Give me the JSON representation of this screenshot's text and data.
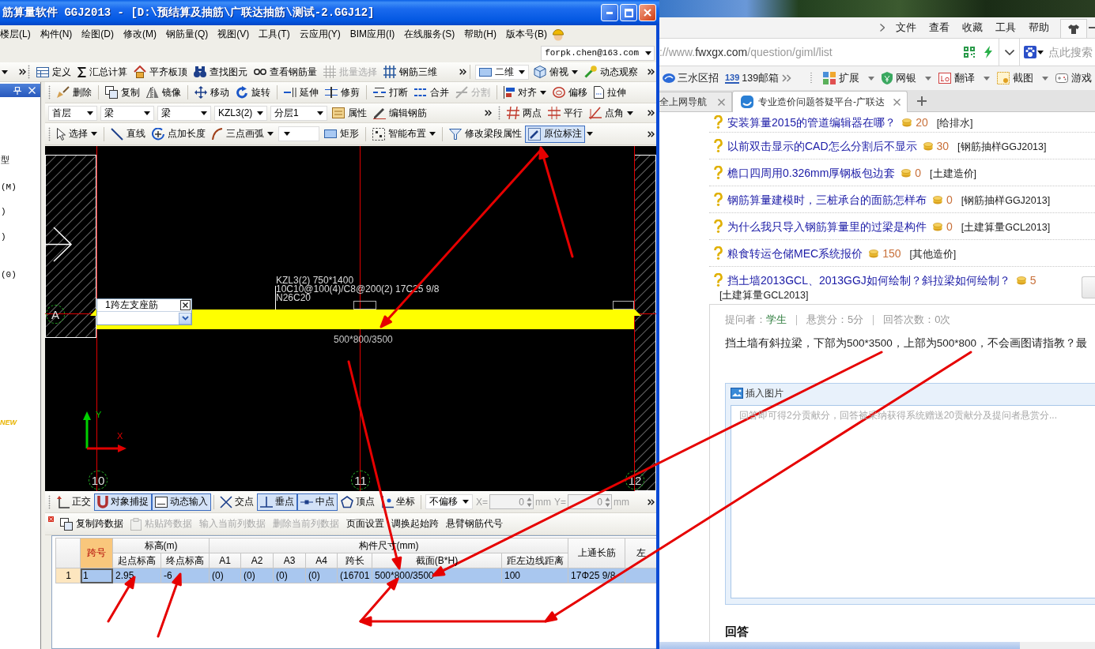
{
  "app_window": {
    "title": "筋算量软件 GGJ2013 - [D:\\预结算及抽筋\\广联达抽筋\\测试-2.GGJ12]",
    "menu": [
      "楼层(L)",
      "构件(N)",
      "绘图(D)",
      "修改(M)",
      "钢筋量(Q)",
      "视图(V)",
      "工具(T)",
      "云应用(Y)",
      "BIM应用(I)",
      "在线服务(S)",
      "帮助(H)",
      "版本号(B)"
    ],
    "account": "forpk.chen@163.com",
    "toolbar_main": [
      {
        "kind": "button",
        "label": "定义",
        "disabled": false
      },
      {
        "kind": "button",
        "label": "汇总计算",
        "disabled": false
      },
      {
        "kind": "button",
        "label": "平齐板顶",
        "disabled": false
      },
      {
        "kind": "button",
        "label": "查找图元",
        "disabled": false
      },
      {
        "kind": "button",
        "label": "查看钢筋量",
        "disabled": false
      },
      {
        "kind": "button",
        "label": "批量选择",
        "disabled": true
      },
      {
        "kind": "button",
        "label": "钢筋三维",
        "disabled": false
      }
    ],
    "toolbar_view": [
      {
        "kind": "select",
        "label": "二维"
      },
      {
        "kind": "menu",
        "label": "俯视"
      },
      {
        "kind": "button",
        "label": "动态观察"
      }
    ],
    "side_panel": {
      "items": [
        "型",
        "(M)",
        ")",
        ")",
        "(0)"
      ],
      "badge": "NEW"
    },
    "toolbar_edit": [
      {
        "kind": "button",
        "label": "删除",
        "disabled": false
      },
      {
        "kind": "button",
        "label": "复制",
        "disabled": false
      },
      {
        "kind": "button",
        "label": "镜像",
        "disabled": false
      },
      {
        "kind": "button",
        "label": "移动",
        "disabled": false
      },
      {
        "kind": "button",
        "label": "旋转",
        "disabled": false
      },
      {
        "kind": "button",
        "label": "延伸",
        "disabled": false
      },
      {
        "kind": "button",
        "label": "修剪",
        "disabled": false
      },
      {
        "kind": "button",
        "label": "打断",
        "disabled": false
      },
      {
        "kind": "button",
        "label": "合并",
        "disabled": false
      },
      {
        "kind": "button",
        "label": "分割",
        "disabled": true
      },
      {
        "kind": "menu",
        "label": "对齐",
        "disabled": false
      },
      {
        "kind": "button",
        "label": "偏移",
        "disabled": false
      },
      {
        "kind": "button",
        "label": "拉伸",
        "disabled": false
      }
    ],
    "toolbar_layer": [
      {
        "kind": "select",
        "label": "首层"
      },
      {
        "kind": "select",
        "label": "梁"
      },
      {
        "kind": "select",
        "label": "梁"
      },
      {
        "kind": "select",
        "label": "KZL3(2)"
      },
      {
        "kind": "select",
        "label": "分层1"
      },
      {
        "kind": "button",
        "label": "属性"
      },
      {
        "kind": "button",
        "label": "编辑钢筋"
      }
    ],
    "toolbar_point": [
      {
        "kind": "button",
        "label": "两点"
      },
      {
        "kind": "button",
        "label": "平行"
      },
      {
        "kind": "menu",
        "label": "点角"
      }
    ],
    "toolbar_draw": [
      {
        "kind": "menu",
        "label": "选择",
        "on": false
      },
      {
        "kind": "button",
        "label": "直线",
        "on": false
      },
      {
        "kind": "button",
        "label": "点加长度",
        "on": false
      },
      {
        "kind": "menu",
        "label": "三点画弧",
        "on": false
      },
      {
        "kind": "select",
        "on": false
      },
      {
        "kind": "button",
        "label": "矩形",
        "on": false
      },
      {
        "kind": "menu",
        "label": "智能布置",
        "on": false
      },
      {
        "kind": "button",
        "label": "修改梁段属性",
        "on": false
      },
      {
        "kind": "split",
        "label": "原位标注",
        "on": true
      }
    ],
    "canvas": {
      "axes": [
        "A",
        "10",
        "11",
        "12"
      ],
      "beam_text": [
        "KZL3(2) 750*1400",
        "10C10@100(4)/C8@200(2) 17C25 9/8",
        "N26C20"
      ],
      "section": "500*800/3500",
      "editor_title": "1跨左支座筋",
      "axis_y": "Y",
      "axis_x": "X"
    },
    "toolbar_snap": [
      {
        "kind": "button",
        "label": "正交",
        "on": false
      },
      {
        "kind": "button",
        "label": "对象捕捉",
        "on": true
      },
      {
        "kind": "button",
        "label": "动态输入",
        "on": true
      },
      {
        "kind": "button",
        "label": "交点",
        "on": false
      },
      {
        "kind": "button",
        "label": "垂点",
        "on": true
      },
      {
        "kind": "button",
        "label": "中点",
        "on": true
      },
      {
        "kind": "button",
        "label": "顶点",
        "on": false
      },
      {
        "kind": "button",
        "label": "坐标",
        "on": false
      }
    ],
    "offset": {
      "mode": "不偏移",
      "x_label": "X=",
      "x_value": "0",
      "x_unit": "mm",
      "y_label": "Y=",
      "y_value": "0",
      "y_unit": "mm",
      "disabled": true
    },
    "span_toolbar": [
      {
        "label": "复制跨数据",
        "disabled": false
      },
      {
        "label": "粘贴跨数据",
        "disabled": true
      },
      {
        "label": "输入当前列数据",
        "disabled": true
      },
      {
        "label": "删除当前列数据",
        "disabled": true
      },
      {
        "label": "页面设置",
        "disabled": false
      },
      {
        "label": "调换起始跨",
        "disabled": false
      },
      {
        "label": "悬臂钢筋代号",
        "disabled": false
      }
    ],
    "span_table": {
      "columns": [
        {
          "kind": "index"
        },
        {
          "kind": "key",
          "label": "跨号"
        },
        {
          "kind": "group",
          "label": "标高(m)",
          "children": [
            {
              "label": "起点标高"
            },
            {
              "label": "终点标高"
            }
          ]
        },
        {
          "kind": "group",
          "label": "构件尺寸(mm)",
          "children": [
            {
              "label": "A1"
            },
            {
              "label": "A2"
            },
            {
              "label": "A3"
            },
            {
              "label": "A4"
            },
            {
              "label": "跨长"
            },
            {
              "label": "截面(B*H)"
            },
            {
              "label": "距左边线距离"
            }
          ]
        },
        {
          "kind": "plain",
          "label": "上通长筋"
        },
        {
          "kind": "plain",
          "label": "左"
        }
      ],
      "rows": [
        {
          "selected": true,
          "cells": [
            "1",
            "1",
            [
              "2.95",
              "-6"
            ],
            [
              "(0)",
              "(0)",
              "(0)",
              "(0)",
              "(16701",
              "500*800/3500",
              "100"
            ],
            "17Φ25 9/8"
          ]
        }
      ]
    }
  },
  "browser": {
    "menu": [
      "文件",
      "查看",
      "收藏",
      "工具",
      "帮助"
    ],
    "address": {
      "scheme": "://www.",
      "host": "fwxgx.com",
      "path": "/question/giml/list"
    },
    "search_placeholder": "点此搜索",
    "bookmarks": [
      {
        "label": "三水区招"
      },
      {
        "label": "139邮箱",
        "logo": "139"
      }
    ],
    "extensions": [
      "扩展",
      "网银",
      "翻译",
      "截图",
      "游戏"
    ],
    "tabs": [
      {
        "label": "全上网导航",
        "selected": false
      },
      {
        "label": "专业造价问题答疑平台-广联达",
        "selected": true
      }
    ],
    "questions": [
      {
        "title": "安装算量2015的管道编辑器在哪？",
        "points": "20",
        "tag": "[给排水]"
      },
      {
        "title": "以前双击显示的CAD怎么分割后不显示",
        "points": "30",
        "tag": "[钢筋抽样GGJ2013]"
      },
      {
        "title": "檐口四周用0.326mm厚钢板包边套",
        "points": "0",
        "tag": "[土建造价]"
      },
      {
        "title": "钢筋算量建模时，三桩承台的面筋怎样布",
        "points": "0",
        "tag": "[钢筋抽样GGJ2013]"
      },
      {
        "title": "为什么我只导入钢筋算量里的过梁是构件",
        "points": "0",
        "tag": "[土建算量GCL2013]"
      },
      {
        "title": "粮食转运仓储MEC系统报价",
        "points": "150",
        "tag": "[其他造价]"
      },
      {
        "title": "挡土墙2013GCL、2013GGJ如何绘制？斜拉梁如何绘制？",
        "points": "5",
        "tag": "[土建算量GCL2013]"
      }
    ],
    "detail": {
      "asker_label": "提问者：",
      "asker": "学生",
      "reward": "悬赏分：5分",
      "answer_count": "回答次数：0次",
      "question": "挡土墙有斜拉梁，下部为500*3500，上部为500*800，不会画图请指教？最",
      "insert_image": "插入图片",
      "answer_placeholder": "回答即可得2分贡献分，回答被采纳获得系统赠送20贡献分及提问者悬赏分...",
      "answers_heading": "回答"
    }
  }
}
